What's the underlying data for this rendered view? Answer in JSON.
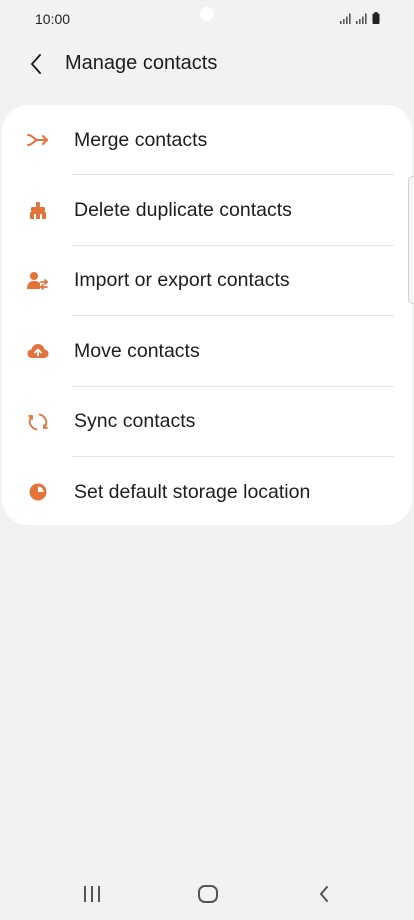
{
  "status_bar": {
    "time": "10:00"
  },
  "header": {
    "back_icon": "chevron-left-icon",
    "title": "Manage contacts"
  },
  "menu": {
    "accent_color": "#e2733a",
    "items": [
      {
        "label": "Merge contacts",
        "icon": "merge-arrow-icon"
      },
      {
        "label": "Delete duplicate contacts",
        "icon": "broom-icon"
      },
      {
        "label": "Import or export contacts",
        "icon": "person-transfer-icon"
      },
      {
        "label": "Move contacts",
        "icon": "cloud-upload-icon"
      },
      {
        "label": "Sync contacts",
        "icon": "sync-icon"
      },
      {
        "label": "Set default storage location",
        "icon": "pie-storage-icon"
      }
    ]
  },
  "nav_bar": {
    "recents_icon": "recents-icon",
    "home_icon": "home-icon",
    "back_icon": "back-icon"
  }
}
